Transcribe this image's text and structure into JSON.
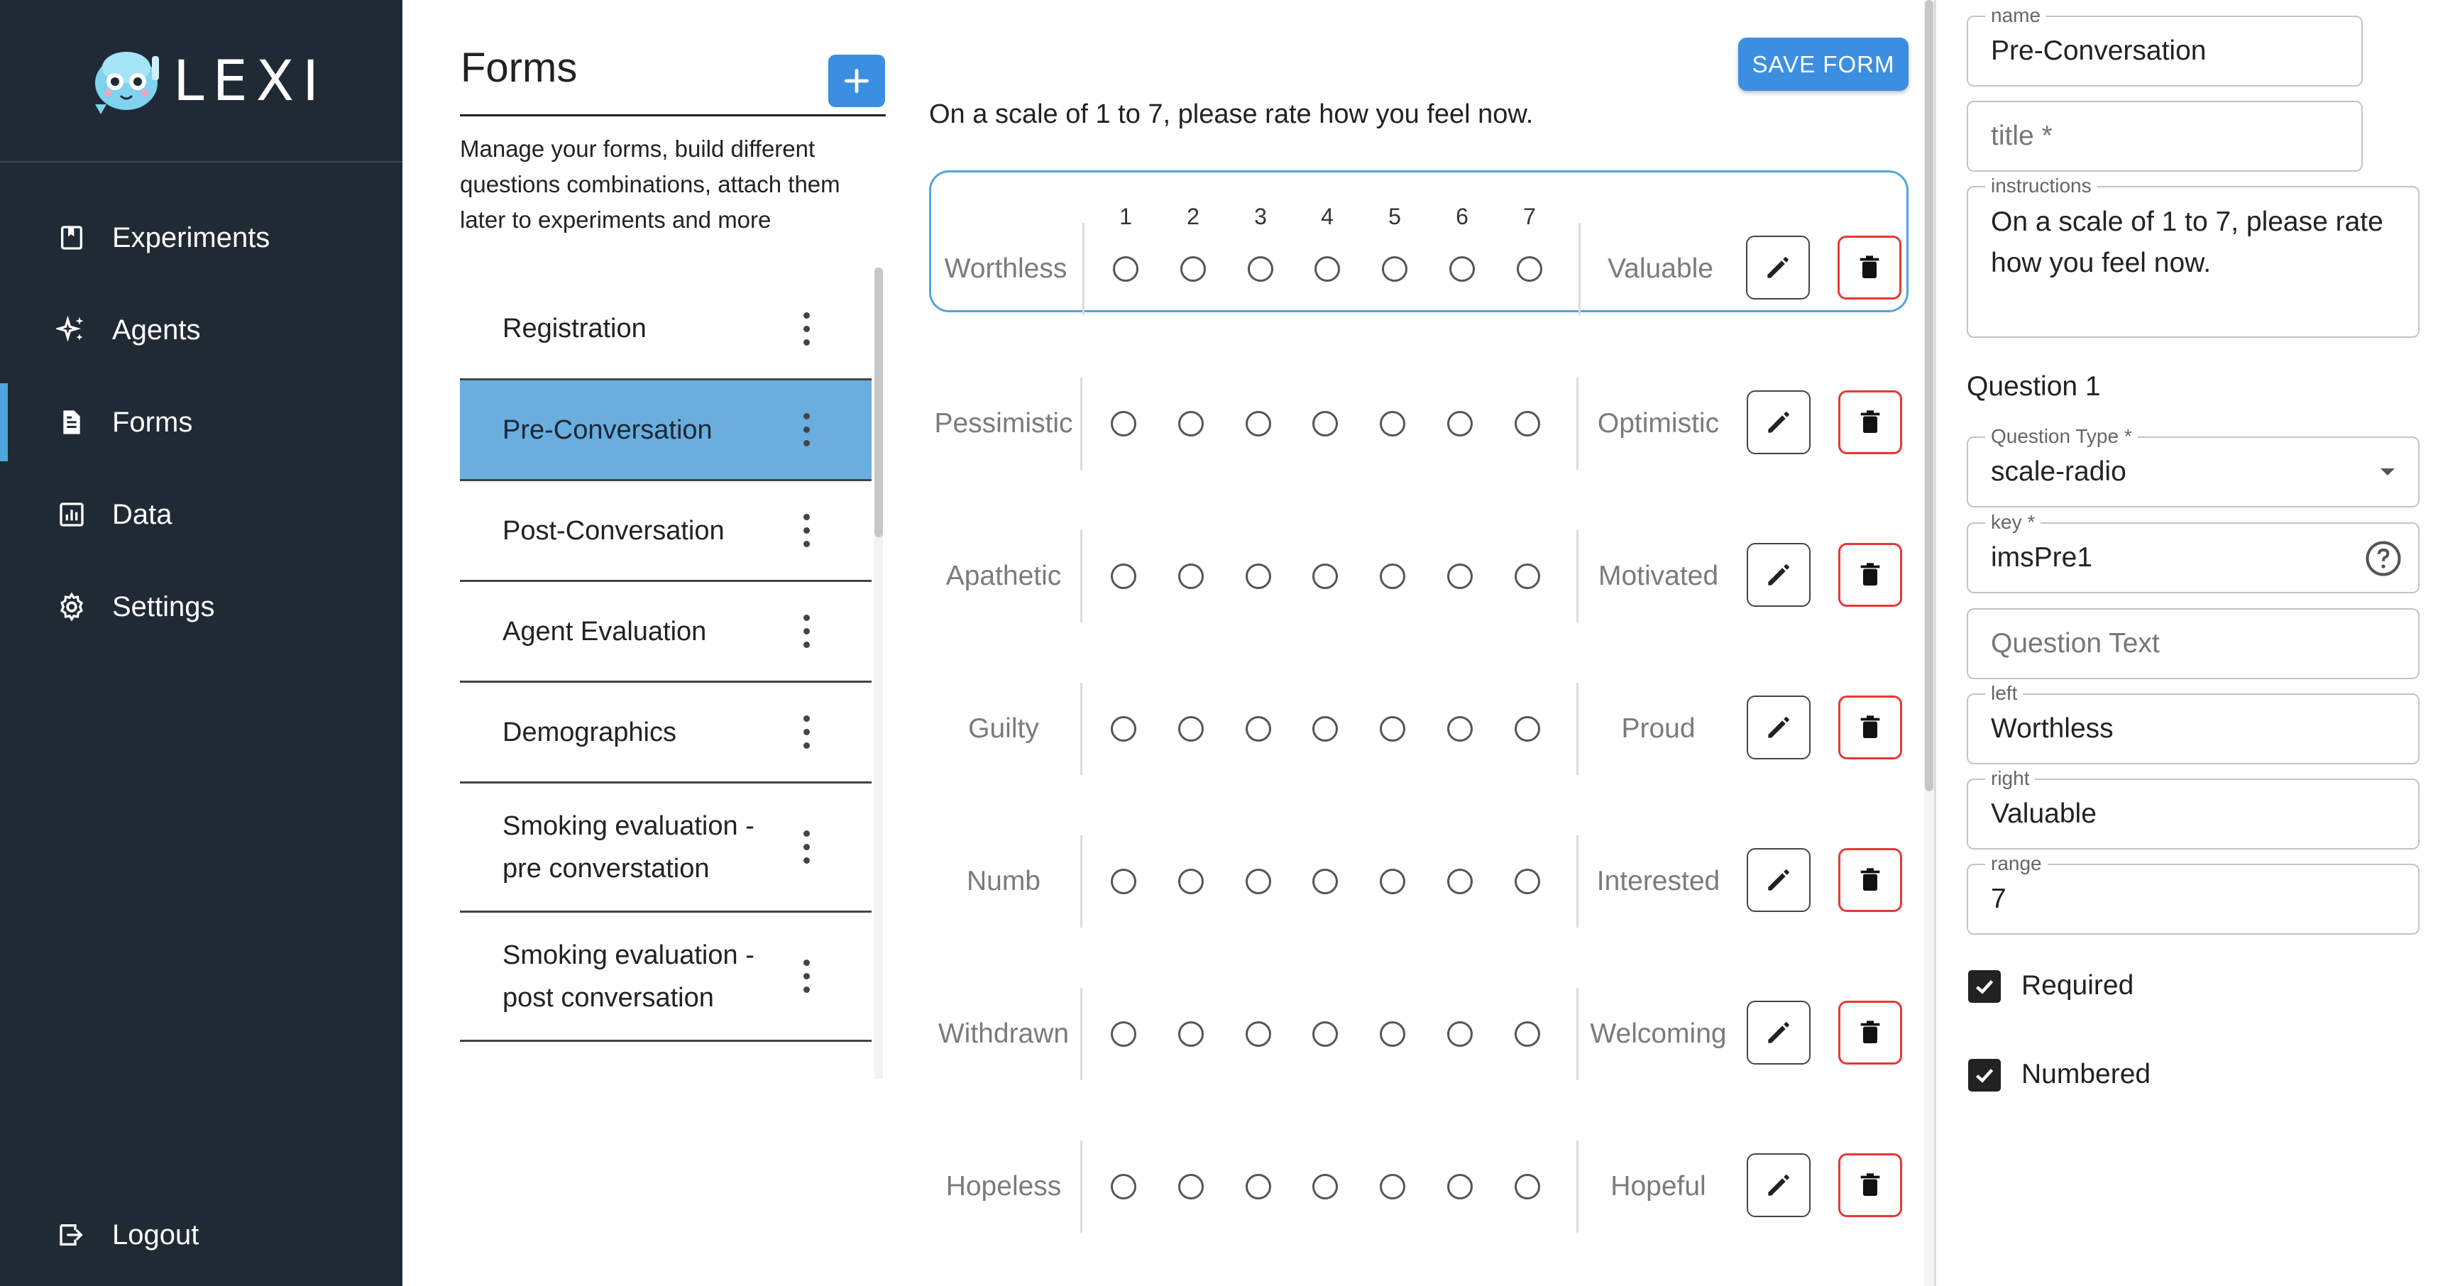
{
  "app": {
    "brand": "LEXI"
  },
  "sidebar": {
    "items": [
      {
        "label": "Experiments",
        "icon": "bookmark-icon"
      },
      {
        "label": "Agents",
        "icon": "sparkles-icon"
      },
      {
        "label": "Forms",
        "icon": "document-icon",
        "active": true
      },
      {
        "label": "Data",
        "icon": "bar-chart-icon"
      },
      {
        "label": "Settings",
        "icon": "gear-icon"
      }
    ],
    "logout": {
      "label": "Logout",
      "icon": "logout-icon"
    }
  },
  "forms_panel": {
    "title": "Forms",
    "add_button": "+",
    "description": "Manage your forms, build different questions combinations, attach them later to experiments and more",
    "items": [
      {
        "label": "Registration",
        "selected": false
      },
      {
        "label": "Pre-Conversation",
        "selected": true
      },
      {
        "label": "Post-Conversation",
        "selected": false
      },
      {
        "label": "Agent Evaluation",
        "selected": false
      },
      {
        "label": "Demographics",
        "selected": false
      },
      {
        "label": "Smoking evaluation - pre converstation",
        "selected": false
      },
      {
        "label": "Smoking evaluation - post conversation",
        "selected": false
      }
    ]
  },
  "editor": {
    "save_label": "SAVE FORM",
    "instructions": "On a scale of 1 to 7, please rate how you feel now.",
    "scale_numbers": [
      "1",
      "2",
      "3",
      "4",
      "5",
      "6",
      "7"
    ],
    "questions": [
      {
        "left": "Worthless",
        "right": "Valuable",
        "active": true
      },
      {
        "left": "Pessimistic",
        "right": "Optimistic"
      },
      {
        "left": "Apathetic",
        "right": "Motivated"
      },
      {
        "left": "Guilty",
        "right": "Proud"
      },
      {
        "left": "Numb",
        "right": "Interested"
      },
      {
        "left": "Withdrawn",
        "right": "Welcoming"
      },
      {
        "left": "Hopeless",
        "right": "Hopeful"
      }
    ]
  },
  "properties": {
    "name": {
      "label": "name",
      "value": "Pre-Conversation"
    },
    "title": {
      "placeholder": "title *"
    },
    "instructions": {
      "label": "instructions",
      "value": "On a scale of 1 to 7, please rate how you feel now."
    },
    "question_heading": "Question 1",
    "question_type": {
      "label": "Question Type *",
      "value": "scale-radio"
    },
    "key": {
      "label": "key *",
      "value": "imsPre1"
    },
    "question_text": {
      "placeholder": "Question Text"
    },
    "left": {
      "label": "left",
      "value": "Worthless"
    },
    "right": {
      "label": "right",
      "value": "Valuable"
    },
    "range": {
      "label": "range",
      "value": "7"
    },
    "required": {
      "label": "Required",
      "checked": true
    },
    "numbered": {
      "label": "Numbered",
      "checked": true
    }
  },
  "colors": {
    "sidebar_bg": "#1f2a35",
    "accent": "#3c8fe0",
    "selected_item": "#6aaedf",
    "delete_red": "#e53935"
  }
}
